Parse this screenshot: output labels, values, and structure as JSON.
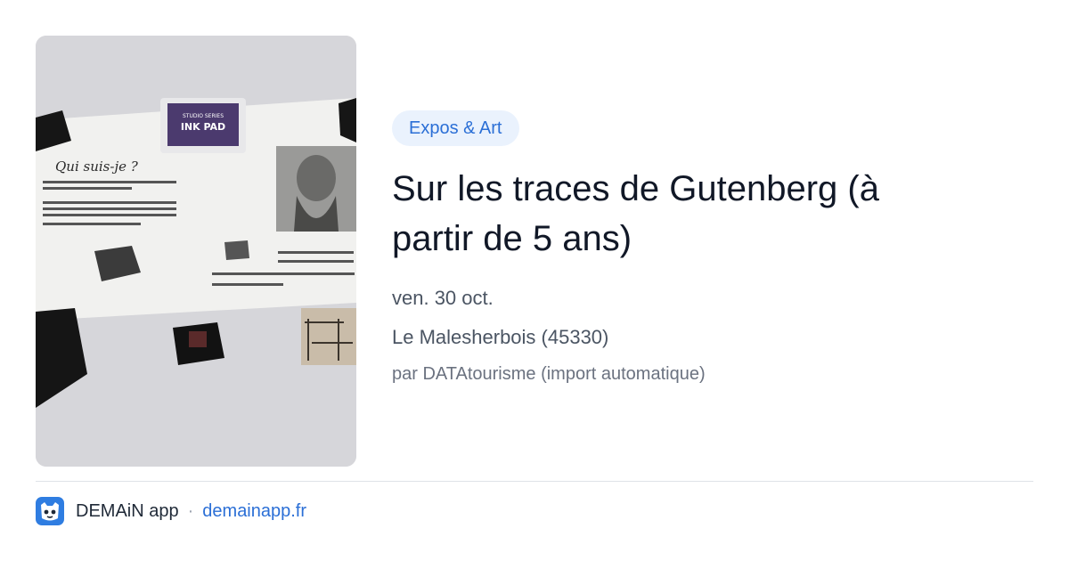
{
  "event": {
    "category": "Expos & Art",
    "title": "Sur les traces de Gutenberg (à partir de 5 ans)",
    "date": "ven. 30 oct.",
    "location": "Le Malesherbois (45330)",
    "source": "par DATAtourisme (import automatique)"
  },
  "image": {
    "ink_pad_brand": "STUDIO SERIES",
    "ink_pad_label": "INK PAD",
    "heading": "Qui suis-je ?"
  },
  "footer": {
    "app_name": "DEMAiN app",
    "separator": "·",
    "site": "demainapp.fr"
  },
  "colors": {
    "accent": "#2b6fd6",
    "tag_background": "#eaf2fd",
    "divider": "#dfe3e8"
  },
  "icons": {
    "logo": "demain-app-logo-icon"
  }
}
